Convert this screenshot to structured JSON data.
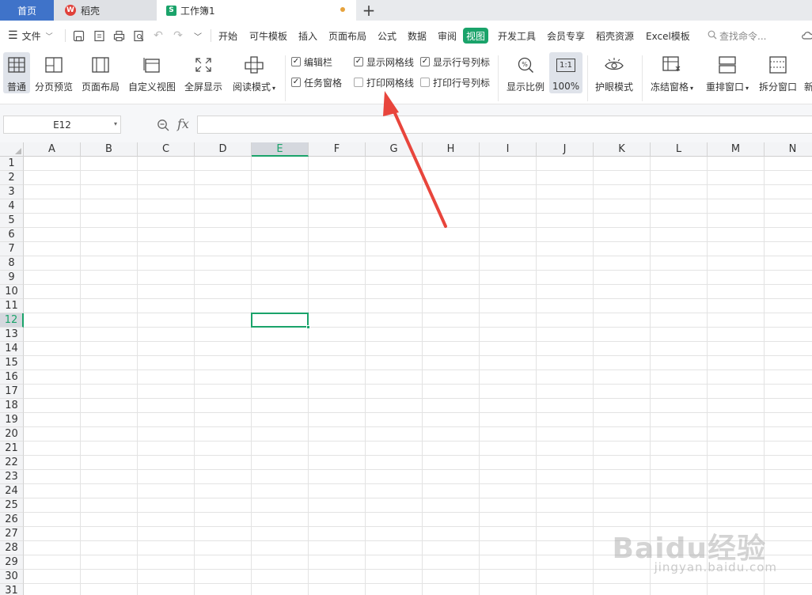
{
  "tabs": {
    "home": "首页",
    "daoke": "稻壳",
    "doc": "工作簿1",
    "add": "+"
  },
  "menubar": {
    "file_label": "文件",
    "items": [
      "开始",
      "可牛模板",
      "插入",
      "页面布局",
      "公式",
      "数据",
      "审阅",
      "视图",
      "开发工具",
      "会员专享",
      "稻壳资源",
      "Excel模板"
    ],
    "active_item": "视图",
    "search_placeholder": "查找命令..."
  },
  "ribbon": {
    "view_buttons": [
      "普通",
      "分页预览",
      "页面布局",
      "自定义视图",
      "全屏显示",
      "阅读模式"
    ],
    "checkboxes": [
      {
        "label": "编辑栏",
        "checked": true
      },
      {
        "label": "显示网格线",
        "checked": true
      },
      {
        "label": "显示行号列标",
        "checked": true
      },
      {
        "label": "任务窗格",
        "checked": true
      },
      {
        "label": "打印网格线",
        "checked": false
      },
      {
        "label": "打印行号列标",
        "checked": false
      }
    ],
    "zoom_buttons": [
      "显示比例",
      "100%"
    ],
    "zoom_icon_text": "1:1",
    "eye_label": "护眼模式",
    "window_buttons": [
      "冻结窗格",
      "重排窗口",
      "拆分窗口",
      "新"
    ]
  },
  "formula_bar": {
    "name_box": "E12",
    "fx": "fx",
    "value": ""
  },
  "sheet": {
    "columns": [
      "A",
      "B",
      "C",
      "D",
      "E",
      "F",
      "G",
      "H",
      "I",
      "J",
      "K",
      "L",
      "M",
      "N"
    ],
    "rows": [
      "1",
      "2",
      "3",
      "4",
      "5",
      "6",
      "7",
      "8",
      "9",
      "10",
      "11",
      "12",
      "13",
      "14",
      "15",
      "16",
      "17",
      "18",
      "19",
      "20",
      "21",
      "22",
      "23",
      "24",
      "25",
      "26",
      "27",
      "28",
      "29",
      "30",
      "31"
    ],
    "active_column": "E",
    "active_row": "12"
  },
  "colors": {
    "accent": "#1aa36a",
    "home_tab": "#3f73c9",
    "arrow": "#e8453c"
  },
  "watermark": {
    "main": "Baidu经验",
    "sub": "jingyan.baidu.com"
  }
}
